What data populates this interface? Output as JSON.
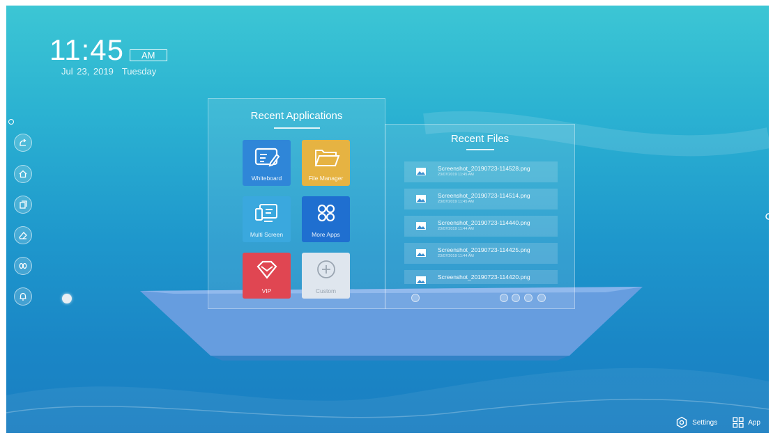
{
  "clock": {
    "time": "11:45",
    "ampm": "AM",
    "date": "Jul 23, 2019",
    "weekday": "Tuesday"
  },
  "sidebar": {
    "items": [
      {
        "icon": "back-icon"
      },
      {
        "icon": "home-icon"
      },
      {
        "icon": "windows-icon"
      },
      {
        "icon": "eraser-icon"
      },
      {
        "icon": "tools-icon"
      },
      {
        "icon": "bell-icon"
      }
    ]
  },
  "recent_apps": {
    "title": "Recent Applications",
    "apps": [
      {
        "label": "Whiteboard",
        "color": "#2f86d8",
        "icon": "whiteboard-icon"
      },
      {
        "label": "File Manager",
        "color": "#e6b342",
        "icon": "folder-icon"
      },
      {
        "label": "Multi Screen",
        "color": "#3aa8de",
        "icon": "multi-screen-icon"
      },
      {
        "label": "More Apps",
        "color": "#1f6fd0",
        "icon": "grid-icon"
      },
      {
        "label": "VIP",
        "color": "#e04652",
        "icon": "diamond-icon"
      },
      {
        "label": "Custom",
        "color": "#dfe6ee",
        "icon": "plus-icon"
      }
    ]
  },
  "recent_files": {
    "title": "Recent Files",
    "files": [
      {
        "name": "Screenshot_20190723-114528.png",
        "date": "23/07/2019 11:45 AM"
      },
      {
        "name": "Screenshot_20190723-114514.png",
        "date": "23/07/2019 11:45 AM"
      },
      {
        "name": "Screenshot_20190723-114440.png",
        "date": "23/07/2019 11:44 AM"
      },
      {
        "name": "Screenshot_20190723-114425.png",
        "date": "23/07/2019 11:44 AM"
      },
      {
        "name": "Screenshot_20190723-114420.png",
        "date": ""
      }
    ]
  },
  "bottom_nav": {
    "settings_label": "Settings",
    "app_label": "App"
  },
  "colors": {
    "bg_top": "#3cc6d4",
    "bg_bottom": "#1b7fc2",
    "boat": "#6a9ee0"
  }
}
